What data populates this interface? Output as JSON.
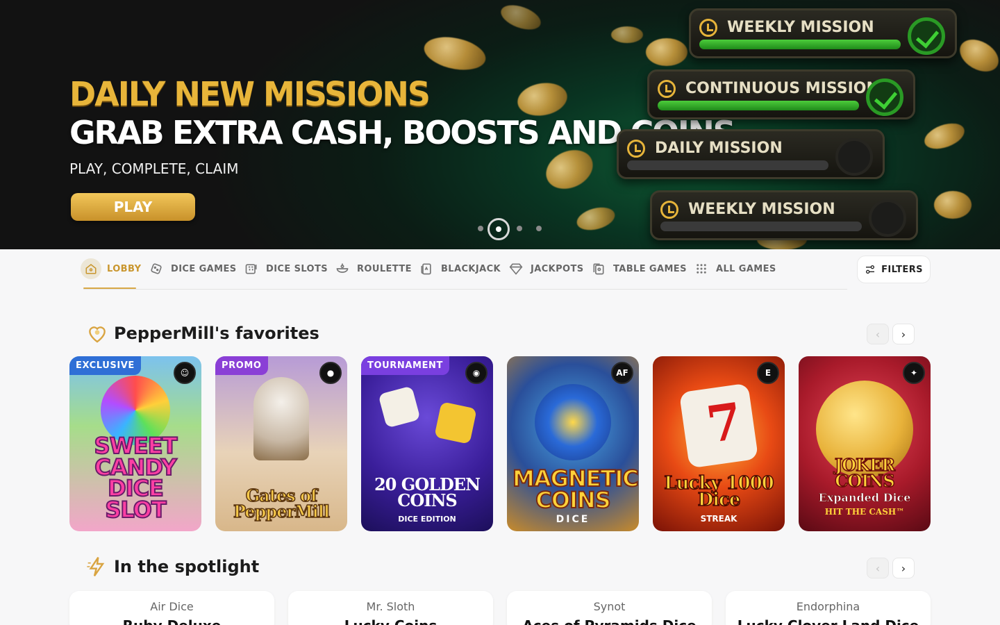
{
  "hero": {
    "title_line1": "DAILY NEW MISSIONS",
    "title_line2": "GRAB EXTRA CASH, BOOSTS AND COINS",
    "subtitle": "PLAY, COMPLETE, CLAIM",
    "play_label": "PLAY",
    "missions": [
      {
        "label": "WEEKLY MISSION",
        "status": "completed"
      },
      {
        "label": "CONTINUOUS MISSION",
        "status": "completed"
      },
      {
        "label": "DAILY MISSION",
        "status": "pending"
      },
      {
        "label": "WEEKLY MISSION",
        "status": "pending"
      }
    ],
    "carousel": {
      "total_slides": 4,
      "active_slide": 2
    }
  },
  "nav": {
    "categories": [
      {
        "label": "LOBBY",
        "icon": "home-icon",
        "active": true
      },
      {
        "label": "DICE GAMES",
        "icon": "dice-icon",
        "active": false
      },
      {
        "label": "DICE SLOTS",
        "icon": "slots-icon",
        "active": false
      },
      {
        "label": "ROULETTE",
        "icon": "roulette-icon",
        "active": false
      },
      {
        "label": "BLACKJACK",
        "icon": "cards-icon",
        "active": false
      },
      {
        "label": "JACKPOTS",
        "icon": "diamond-icon",
        "active": false
      },
      {
        "label": "TABLE GAMES",
        "icon": "table-games-icon",
        "active": false
      },
      {
        "label": "ALL GAMES",
        "icon": "grid-icon",
        "active": false
      }
    ],
    "filters_label": "FILTERS"
  },
  "favorites": {
    "title": "PepperMill's favorites",
    "icon": "heart-icon",
    "cards": [
      {
        "badge": "EXCLUSIVE",
        "badge_color": "#2f6fd6",
        "title": "SWEET CANDY DICE SLOT",
        "provider_icon": "panda-provider-icon"
      },
      {
        "badge": "PROMO",
        "badge_color": "#8a3fd6",
        "title": "Gates of PepperMill",
        "provider_icon": "bomb-provider-icon"
      },
      {
        "badge": "TOURNAMENT",
        "badge_color": "#7a3fe0",
        "title": "20 GOLDEN COINS",
        "subtitle": "DICE EDITION",
        "provider_icon": "eye-provider-icon"
      },
      {
        "badge": "",
        "title": "MAGNETIC COINS",
        "subtitle": "DICE",
        "provider_icon": "af-provider-icon",
        "provider_text": "AF"
      },
      {
        "badge": "",
        "title": "Lucky 1000 Dice",
        "subtitle": "STREAK",
        "provider_icon": "e-provider-icon",
        "provider_text": "E"
      },
      {
        "badge": "",
        "title": "JOKER COINS",
        "subtitle": "Expanded Dice",
        "tagline": "HIT THE CASH™",
        "provider_icon": "fox-provider-icon"
      }
    ]
  },
  "spotlight": {
    "title": "In the spotlight",
    "icon": "lightning-icon",
    "items": [
      {
        "provider": "Air Dice",
        "game": "Ruby Deluxe"
      },
      {
        "provider": "Mr. Sloth",
        "game": "Lucky Coins"
      },
      {
        "provider": "Synot",
        "game": "Aces of Pyramids Dice"
      },
      {
        "provider": "Endorphina",
        "game": "Lucky Clover Land Dice"
      }
    ]
  }
}
